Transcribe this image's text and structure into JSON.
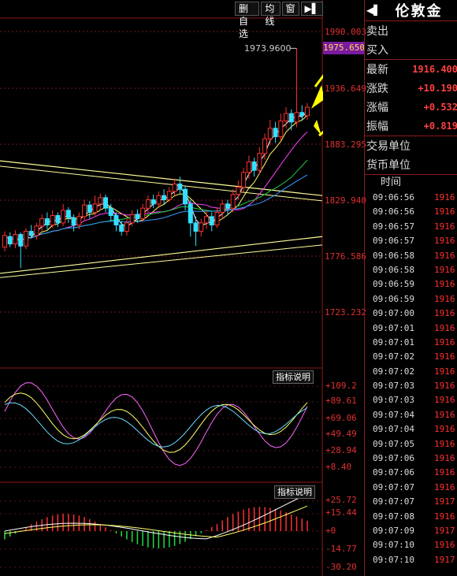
{
  "toolbar": {
    "buttons": [
      "删自选",
      "均线",
      "窗"
    ],
    "play_icon": "▶▌"
  },
  "main_chart": {
    "y_labels": [
      "1990.003",
      "1936.649",
      "1883.295",
      "1829.940",
      "1776.586",
      "1723.232"
    ],
    "peak_label": "1973.9600",
    "current_price_tag": "1975.650",
    "candles": [
      {
        "o": 1785,
        "c": 1796,
        "h": 1800,
        "l": 1781
      },
      {
        "o": 1795,
        "c": 1788,
        "h": 1799,
        "l": 1785
      },
      {
        "o": 1788,
        "c": 1797,
        "h": 1801,
        "l": 1784
      },
      {
        "o": 1797,
        "c": 1786,
        "h": 1799,
        "l": 1765
      },
      {
        "o": 1786,
        "c": 1800,
        "h": 1803,
        "l": 1783
      },
      {
        "o": 1800,
        "c": 1796,
        "h": 1806,
        "l": 1793
      },
      {
        "o": 1796,
        "c": 1805,
        "h": 1808,
        "l": 1792
      },
      {
        "o": 1805,
        "c": 1812,
        "h": 1816,
        "l": 1800
      },
      {
        "o": 1812,
        "c": 1806,
        "h": 1818,
        "l": 1802
      },
      {
        "o": 1806,
        "c": 1815,
        "h": 1820,
        "l": 1803
      },
      {
        "o": 1815,
        "c": 1808,
        "h": 1818,
        "l": 1804
      },
      {
        "o": 1808,
        "c": 1820,
        "h": 1826,
        "l": 1805
      },
      {
        "o": 1820,
        "c": 1813,
        "h": 1823,
        "l": 1808
      },
      {
        "o": 1813,
        "c": 1806,
        "h": 1816,
        "l": 1800
      },
      {
        "o": 1806,
        "c": 1814,
        "h": 1818,
        "l": 1802
      },
      {
        "o": 1814,
        "c": 1825,
        "h": 1830,
        "l": 1810
      },
      {
        "o": 1825,
        "c": 1818,
        "h": 1829,
        "l": 1812
      },
      {
        "o": 1818,
        "c": 1826,
        "h": 1834,
        "l": 1815
      },
      {
        "o": 1826,
        "c": 1832,
        "h": 1836,
        "l": 1820
      },
      {
        "o": 1832,
        "c": 1822,
        "h": 1835,
        "l": 1818
      },
      {
        "o": 1822,
        "c": 1815,
        "h": 1826,
        "l": 1810
      },
      {
        "o": 1815,
        "c": 1806,
        "h": 1818,
        "l": 1800
      },
      {
        "o": 1806,
        "c": 1800,
        "h": 1810,
        "l": 1796
      },
      {
        "o": 1800,
        "c": 1808,
        "h": 1812,
        "l": 1796
      },
      {
        "o": 1808,
        "c": 1816,
        "h": 1820,
        "l": 1805
      },
      {
        "o": 1816,
        "c": 1812,
        "h": 1821,
        "l": 1808
      },
      {
        "o": 1812,
        "c": 1822,
        "h": 1826,
        "l": 1809
      },
      {
        "o": 1822,
        "c": 1830,
        "h": 1834,
        "l": 1818
      },
      {
        "o": 1830,
        "c": 1826,
        "h": 1835,
        "l": 1822
      },
      {
        "o": 1826,
        "c": 1834,
        "h": 1838,
        "l": 1822
      },
      {
        "o": 1834,
        "c": 1830,
        "h": 1840,
        "l": 1826
      },
      {
        "o": 1830,
        "c": 1838,
        "h": 1842,
        "l": 1828
      },
      {
        "o": 1838,
        "c": 1845,
        "h": 1850,
        "l": 1834
      },
      {
        "o": 1845,
        "c": 1840,
        "h": 1852,
        "l": 1836
      },
      {
        "o": 1840,
        "c": 1826,
        "h": 1843,
        "l": 1820
      },
      {
        "o": 1826,
        "c": 1808,
        "h": 1830,
        "l": 1795
      },
      {
        "o": 1808,
        "c": 1800,
        "h": 1814,
        "l": 1786
      },
      {
        "o": 1800,
        "c": 1808,
        "h": 1812,
        "l": 1795
      },
      {
        "o": 1808,
        "c": 1814,
        "h": 1820,
        "l": 1802
      },
      {
        "o": 1814,
        "c": 1806,
        "h": 1818,
        "l": 1800
      },
      {
        "o": 1806,
        "c": 1818,
        "h": 1822,
        "l": 1803
      },
      {
        "o": 1818,
        "c": 1826,
        "h": 1830,
        "l": 1812
      },
      {
        "o": 1826,
        "c": 1822,
        "h": 1830,
        "l": 1815
      },
      {
        "o": 1822,
        "c": 1835,
        "h": 1840,
        "l": 1818
      },
      {
        "o": 1835,
        "c": 1842,
        "h": 1848,
        "l": 1830
      },
      {
        "o": 1842,
        "c": 1856,
        "h": 1860,
        "l": 1838
      },
      {
        "o": 1856,
        "c": 1866,
        "h": 1872,
        "l": 1850
      },
      {
        "o": 1866,
        "c": 1858,
        "h": 1870,
        "l": 1852
      },
      {
        "o": 1858,
        "c": 1874,
        "h": 1880,
        "l": 1854
      },
      {
        "o": 1874,
        "c": 1888,
        "h": 1893,
        "l": 1868
      },
      {
        "o": 1888,
        "c": 1898,
        "h": 1906,
        "l": 1882
      },
      {
        "o": 1898,
        "c": 1890,
        "h": 1904,
        "l": 1884
      },
      {
        "o": 1890,
        "c": 1905,
        "h": 1912,
        "l": 1886
      },
      {
        "o": 1905,
        "c": 1912,
        "h": 1918,
        "l": 1898
      },
      {
        "o": 1912,
        "c": 1904,
        "h": 1916,
        "l": 1896
      },
      {
        "o": 1904,
        "c": 1913,
        "h": 1974,
        "l": 1899
      },
      {
        "o": 1913,
        "c": 1910,
        "h": 1920,
        "l": 1905
      },
      {
        "o": 1910,
        "c": 1918,
        "h": 1922,
        "l": 1906
      }
    ]
  },
  "sub1": {
    "button": "指标说明",
    "labels": [
      "+109.2",
      "+89.61",
      "+69.06",
      "+49.49",
      "+28.94",
      "+8.40"
    ]
  },
  "sub2": {
    "button": "指标说明",
    "labels": [
      "+25.72",
      "+15.44",
      "+0",
      "-14.77",
      "-30.20"
    ]
  },
  "panel": {
    "back_icon": "◀▌",
    "title": "伦敦金",
    "rows1": [
      {
        "k": "卖出",
        "v": ""
      },
      {
        "k": "买入",
        "v": ""
      }
    ],
    "rows2": [
      {
        "k": "最新",
        "v": "1916.400"
      },
      {
        "k": "涨跌",
        "v": "+10.190"
      },
      {
        "k": "涨幅",
        "v": "+0.532"
      },
      {
        "k": "振幅",
        "v": "+0.819"
      }
    ],
    "rows3": [
      {
        "k": "交易单位",
        "v": ""
      },
      {
        "k": "货币单位",
        "v": ""
      }
    ],
    "tick_header": "时间",
    "ticks": [
      {
        "t": "09:06:56",
        "p": "1916"
      },
      {
        "t": "09:06:56",
        "p": "1916"
      },
      {
        "t": "09:06:57",
        "p": "1916"
      },
      {
        "t": "09:06:57",
        "p": "1916"
      },
      {
        "t": "09:06:58",
        "p": "1916"
      },
      {
        "t": "09:06:58",
        "p": "1916"
      },
      {
        "t": "09:06:59",
        "p": "1916"
      },
      {
        "t": "09:06:59",
        "p": "1916"
      },
      {
        "t": "09:07:00",
        "p": "1916"
      },
      {
        "t": "09:07:01",
        "p": "1916"
      },
      {
        "t": "09:07:01",
        "p": "1916"
      },
      {
        "t": "09:07:02",
        "p": "1916"
      },
      {
        "t": "09:07:02",
        "p": "1916"
      },
      {
        "t": "09:07:03",
        "p": "1916"
      },
      {
        "t": "09:07:03",
        "p": "1916"
      },
      {
        "t": "09:07:04",
        "p": "1916"
      },
      {
        "t": "09:07:04",
        "p": "1916"
      },
      {
        "t": "09:07:05",
        "p": "1916"
      },
      {
        "t": "09:07:06",
        "p": "1916"
      },
      {
        "t": "09:07:06",
        "p": "1916"
      },
      {
        "t": "09:07:07",
        "p": "1916"
      },
      {
        "t": "09:07:07",
        "p": "1917"
      },
      {
        "t": "09:07:08",
        "p": "1916"
      },
      {
        "t": "09:07:09",
        "p": "1917"
      },
      {
        "t": "09:07:10",
        "p": "1916"
      },
      {
        "t": "09:07:10",
        "p": "1917"
      }
    ]
  },
  "colors": {
    "up": "#ff3030",
    "down": "#33e0ff",
    "ma1": "#ffffff",
    "ma2": "#ffff66",
    "ma3": "#ff44ff",
    "ma4": "#22cc44",
    "ma5": "#3399ff",
    "trend": "#ffff99",
    "annotation": "#ffff00",
    "frame": "#8b1a1a"
  }
}
